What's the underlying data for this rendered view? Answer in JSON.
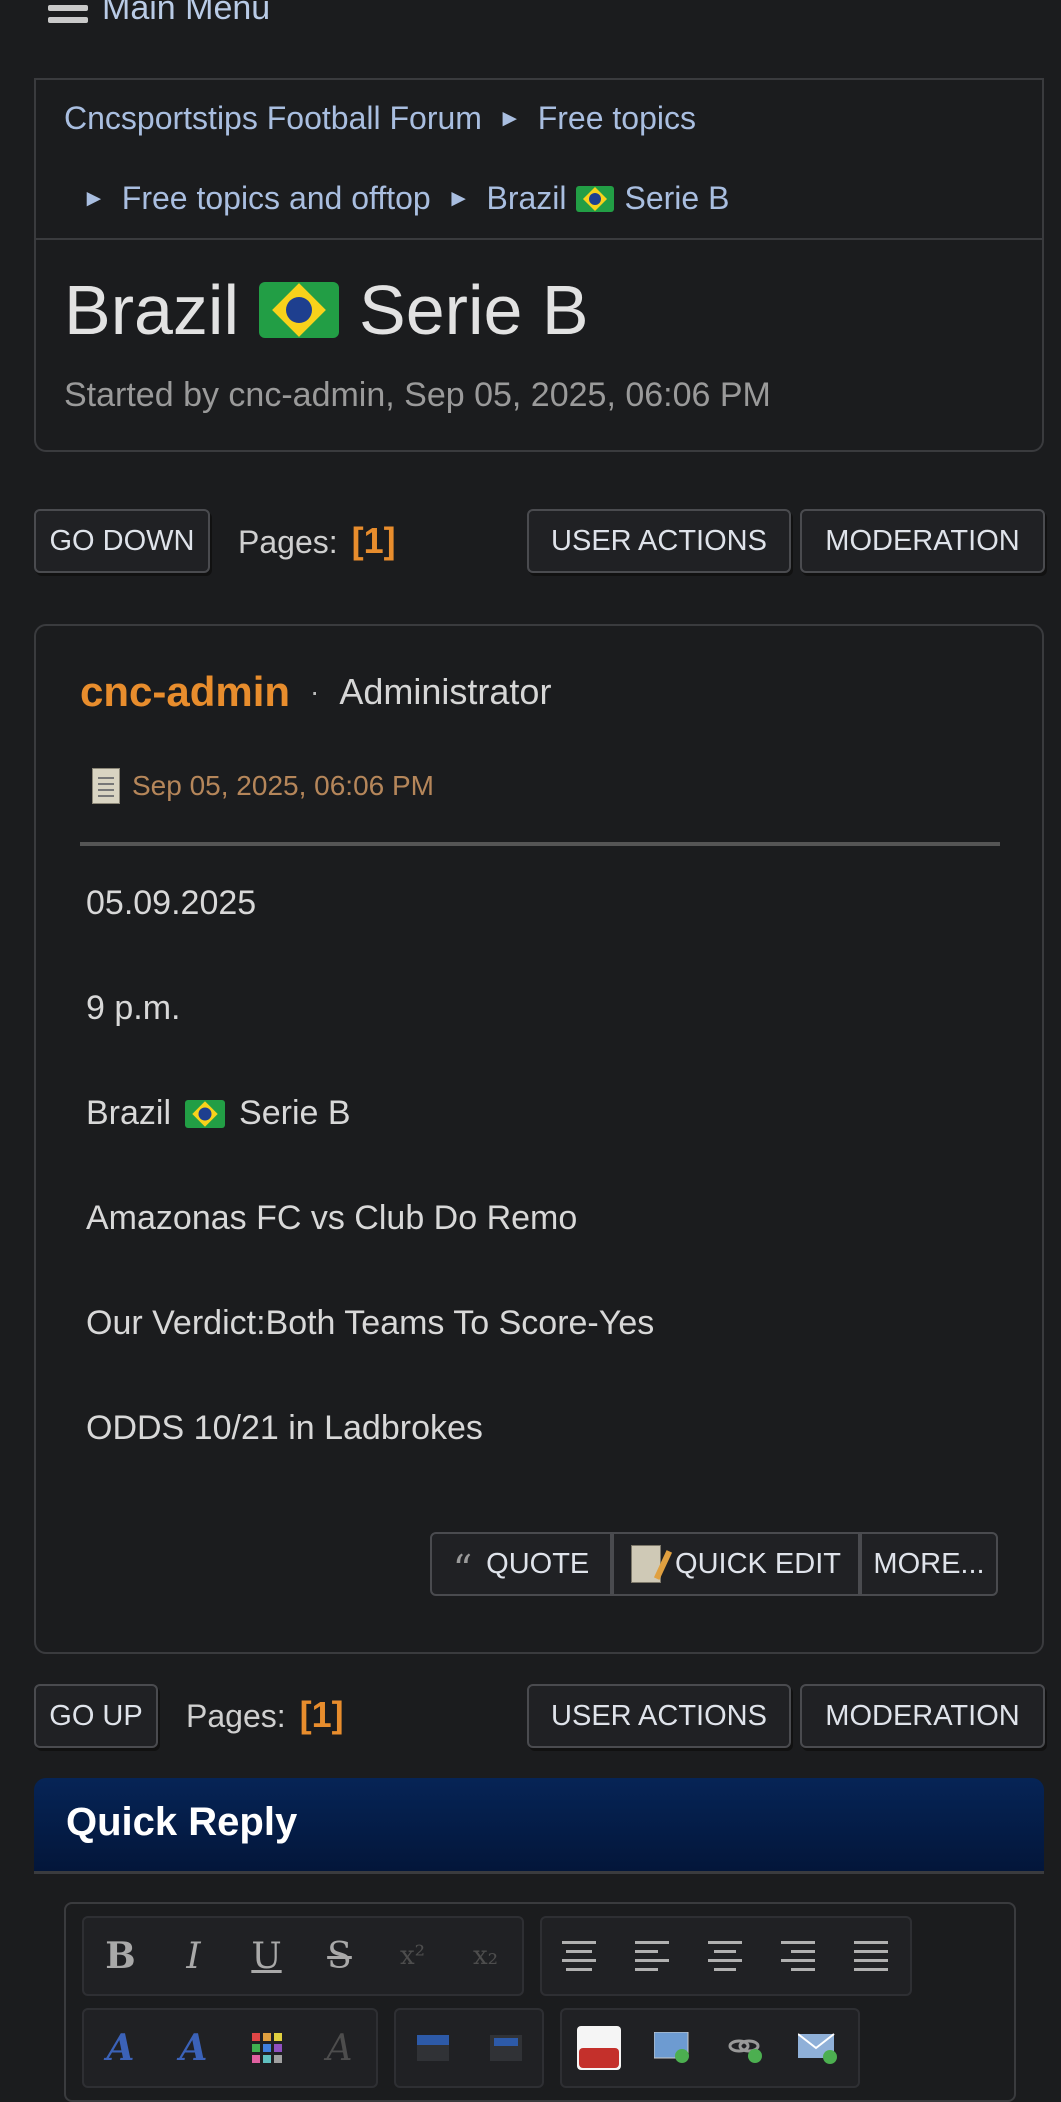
{
  "menu": {
    "label": "Main Menu"
  },
  "breadcrumb": {
    "items": [
      "Cncsportstips Football Forum",
      "Free topics",
      "Free topics and offtop"
    ],
    "current_prefix": "Brazil",
    "current_suffix": "Serie B"
  },
  "topic": {
    "title_prefix": "Brazil",
    "title_suffix": "Serie B",
    "started_by": "Started by cnc-admin, Sep 05, 2025, 06:06 PM"
  },
  "nav_top": {
    "go_down": "Go Down",
    "pages_label": "Pages:",
    "pages_value": "[1]",
    "user_actions": "User actions",
    "moderation": "Moderation"
  },
  "post": {
    "author": "cnc-admin",
    "role": "Administrator",
    "date": "Sep 05, 2025, 06:06 PM",
    "lines": {
      "date": "05.09.2025",
      "time": "9 p.m.",
      "league_prefix": "Brazil",
      "league_suffix": "Serie B",
      "match": "Amazonas FC vs Club Do Remo",
      "verdict": "Our Verdict:Both Teams To Score-Yes",
      "odds": "ODDS 10/21 in Ladbrokes"
    },
    "actions": {
      "quote": "Quote",
      "quick_edit": "Quick Edit",
      "more": "More..."
    }
  },
  "nav_bottom": {
    "go_up": "Go Up",
    "pages_label": "Pages:",
    "pages_value": "[1]",
    "user_actions": "User actions",
    "moderation": "Moderation"
  },
  "quick_reply": {
    "title": "Quick Reply",
    "toolbar": {
      "bold": "B",
      "italic": "I",
      "underline": "U",
      "strike": "S",
      "superscript": "x²",
      "subscript": "x₂"
    }
  },
  "colors": {
    "accent": "#e88d2d",
    "link": "#a9bee0",
    "quick_reply_header": "#062456"
  }
}
